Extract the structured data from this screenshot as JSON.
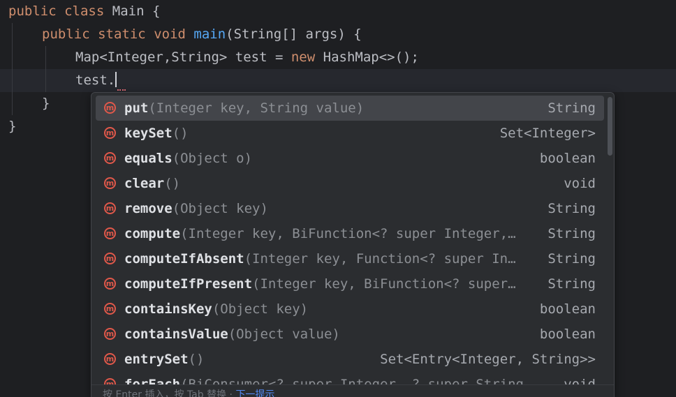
{
  "code": {
    "line1": {
      "kw1": "public",
      "kw2": "class",
      "name": "Main {"
    },
    "line2": {
      "kw1": "public",
      "kw2": "static",
      "kw3": "void",
      "fn": "main",
      "rest": "(String[] args) {"
    },
    "line3": {
      "pre": "Map<Integer,String> test = ",
      "kw": "new",
      "post": " HashMap<>();"
    },
    "line4": {
      "text": "test."
    },
    "line5": {
      "text": "}"
    },
    "line6": {
      "text": "}"
    }
  },
  "completion": {
    "items": [
      {
        "name": "put",
        "params": "(Integer key, String value)",
        "type": "String"
      },
      {
        "name": "keySet",
        "params": "()",
        "type": "Set<Integer>"
      },
      {
        "name": "equals",
        "params": "(Object o)",
        "type": "boolean"
      },
      {
        "name": "clear",
        "params": "()",
        "type": "void"
      },
      {
        "name": "remove",
        "params": "(Object key)",
        "type": "String"
      },
      {
        "name": "compute",
        "params": "(Integer key, BiFunction<? super Integer,…",
        "type": "String"
      },
      {
        "name": "computeIfAbsent",
        "params": "(Integer key, Function<? super In…",
        "type": "String"
      },
      {
        "name": "computeIfPresent",
        "params": "(Integer key, BiFunction<? super…",
        "type": "String"
      },
      {
        "name": "containsKey",
        "params": "(Object key)",
        "type": "boolean"
      },
      {
        "name": "containsValue",
        "params": "(Object value)",
        "type": "boolean"
      },
      {
        "name": "entrySet",
        "params": "()",
        "type": "Set<Entry<Integer, String>>"
      },
      {
        "name": "forEach",
        "params": "(BiConsumer<? super Integer, ? super String…",
        "type": "void"
      }
    ],
    "icon_letter": "m",
    "footer": {
      "enter_hint": "按 Enter 插入，按 Tab 替换",
      "next_tip": "下一提示"
    }
  },
  "colors": {
    "background": "#1e1f22",
    "keyword": "#cf8e6d",
    "function": "#56a8f5",
    "method_icon": "#e0584a",
    "popup_bg": "#2b2d30",
    "selected_row": "#43454a"
  }
}
